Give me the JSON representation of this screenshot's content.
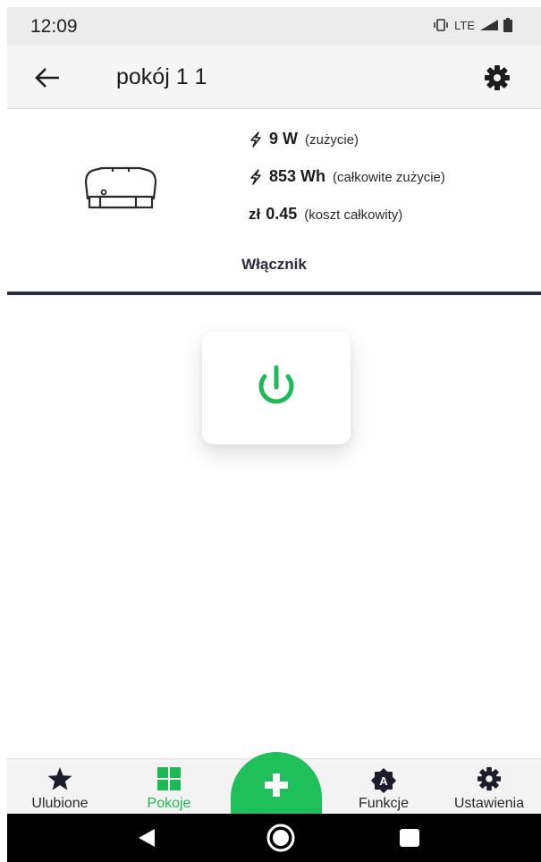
{
  "status_bar": {
    "time": "12:09",
    "network": "LTE"
  },
  "header": {
    "title": "pokój 1 1",
    "back_icon": "arrow-left-icon",
    "settings_icon": "gear-icon"
  },
  "device": {
    "icon": "socket-module-icon",
    "usage_value": "9 W",
    "usage_label": "(zużycie)",
    "total_value": "853 Wh",
    "total_label": "(całkowite zużycie)",
    "cost_currency": "zł",
    "cost_value": "0.45",
    "cost_label": "(koszt całkowity)"
  },
  "switch": {
    "title": "Włącznik",
    "power_icon": "power-icon",
    "power_color": "#1db954"
  },
  "bottom_nav": {
    "items": [
      {
        "label": "Ulubione",
        "icon": "star-icon",
        "active": false
      },
      {
        "label": "Pokoje",
        "icon": "grid-icon",
        "active": true
      },
      {
        "label": "Funkcje",
        "icon": "badge-a-icon",
        "active": false
      },
      {
        "label": "Ustawienia",
        "icon": "gear-icon",
        "active": false
      }
    ],
    "fab_icon": "plus-icon",
    "accent": "#1fbf5a"
  },
  "system_nav": {
    "back_icon": "triangle-back-icon",
    "home_icon": "circle-home-icon",
    "recent_icon": "square-recent-icon"
  }
}
